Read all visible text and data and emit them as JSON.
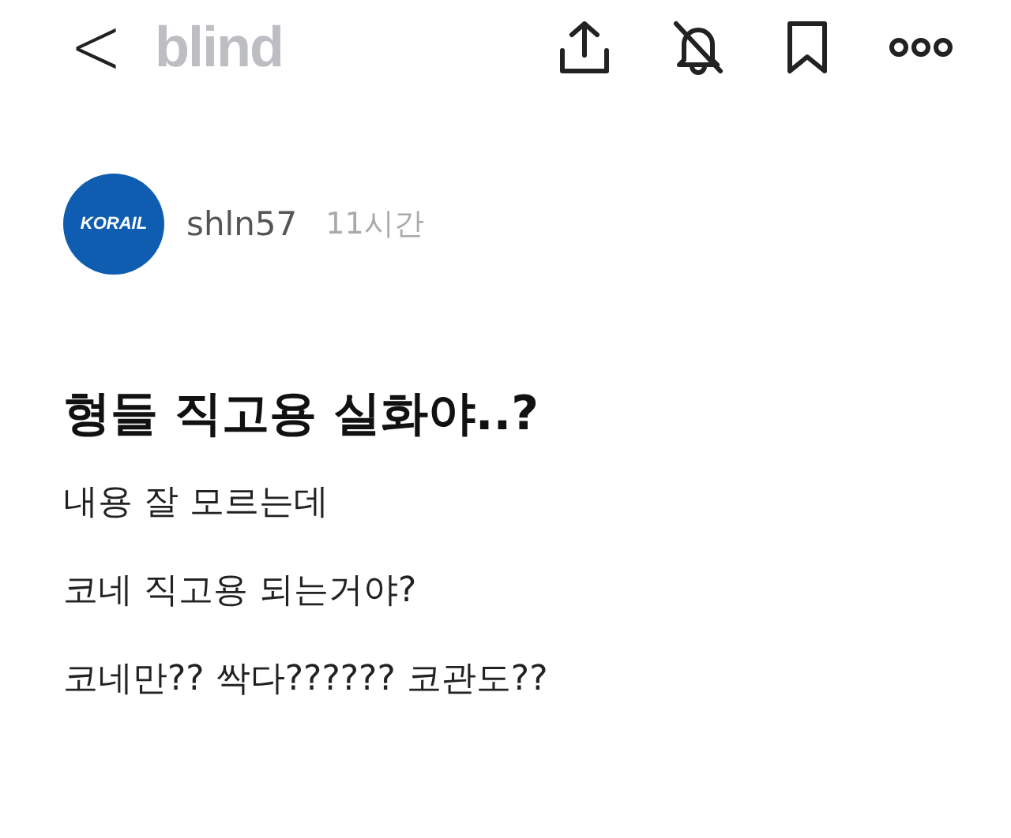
{
  "header": {
    "back": "<",
    "logo": "blind"
  },
  "post": {
    "avatar_text": "KORAIL",
    "author": "shln57",
    "time": "11시간",
    "title": "형들 직고용 실화야..?",
    "lines": [
      "내용 잘 모르는데",
      "코네 직고용 되는거야?",
      "코네만?? 싹다?????? 코관도??"
    ]
  }
}
